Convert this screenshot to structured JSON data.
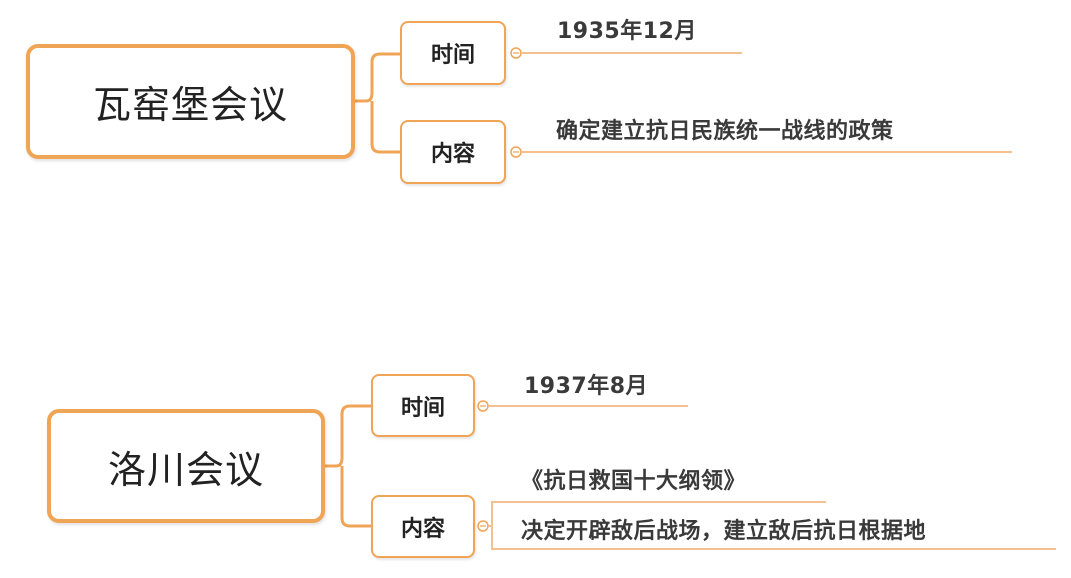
{
  "colors": {
    "accent": "#f0a455",
    "leaf_line": "#f5c08f",
    "text": "#3a3a3a"
  },
  "meetings": [
    {
      "title": "瓦窑堡会议",
      "time_label": "时间",
      "time_value": "1935年12月",
      "content_label": "内容",
      "content_value": "确定建立抗日民族统一战线的政策"
    },
    {
      "title": "洛川会议",
      "time_label": "时间",
      "time_value": "1937年8月",
      "content_label": "内容",
      "content_value_1": "《抗日救国十大纲领》",
      "content_value_2": "决定开辟敌后战场，建立敌后抗日根据地"
    }
  ]
}
